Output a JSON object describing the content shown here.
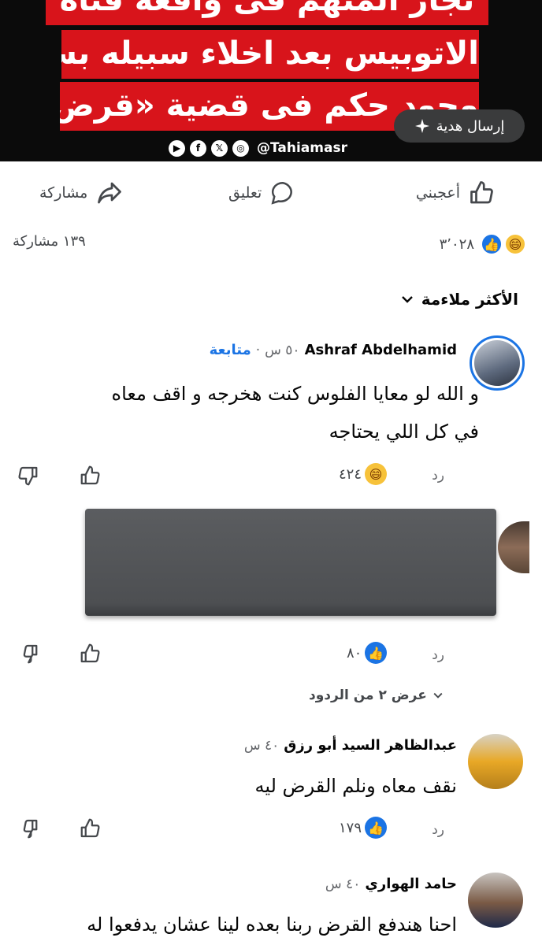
{
  "banner": {
    "line1": "تجار المتهم فى واقعة فتاة",
    "line2": "الاتوبيس بعد اخلاء سبيله بسبب",
    "line3": "وجود حكم فى قضية «قرض»",
    "handle": "@Tahiamasr",
    "social_icons": [
      "youtube-icon",
      "facebook-icon",
      "x-icon",
      "instagram-icon"
    ],
    "gift_label": "إرسال هدية"
  },
  "actions": {
    "like": "أعجبني",
    "comment": "تعليق",
    "share": "مشاركة"
  },
  "stats": {
    "reactions_count": "٣٬٠٢٨",
    "shares": "١٣٩ مشاركة"
  },
  "sort": {
    "label": "الأكثر ملاءمة"
  },
  "comments": [
    {
      "name": "Ashraf Abdelhamid",
      "time": "٥٠ س",
      "follow": "متابعة",
      "line1": "و الله لو معايا الفلوس كنت هخرجه و اقف معاه",
      "line2": "في كل اللي يحتاجه",
      "reply": "رد",
      "reactions": "٤٢٤"
    },
    {
      "reply": "رد",
      "reactions": "٨٠",
      "show_replies": "عرض ٢ من الردود"
    },
    {
      "name": "عبدالظاهر السيد أبو رزق",
      "time": "٤٠ س",
      "text": "نقف معاه ونلم القرض ليه",
      "reply": "رد",
      "reactions": "١٧٩"
    },
    {
      "name": "حامد الهواري",
      "time": "٤٠ س",
      "text": "احنا هندفع القرض ربنا بعده لينا عشان يدفعوا له"
    }
  ],
  "colors": {
    "accent": "#1b74e4",
    "banner_red": "#d8141b",
    "muted": "#65676b"
  }
}
